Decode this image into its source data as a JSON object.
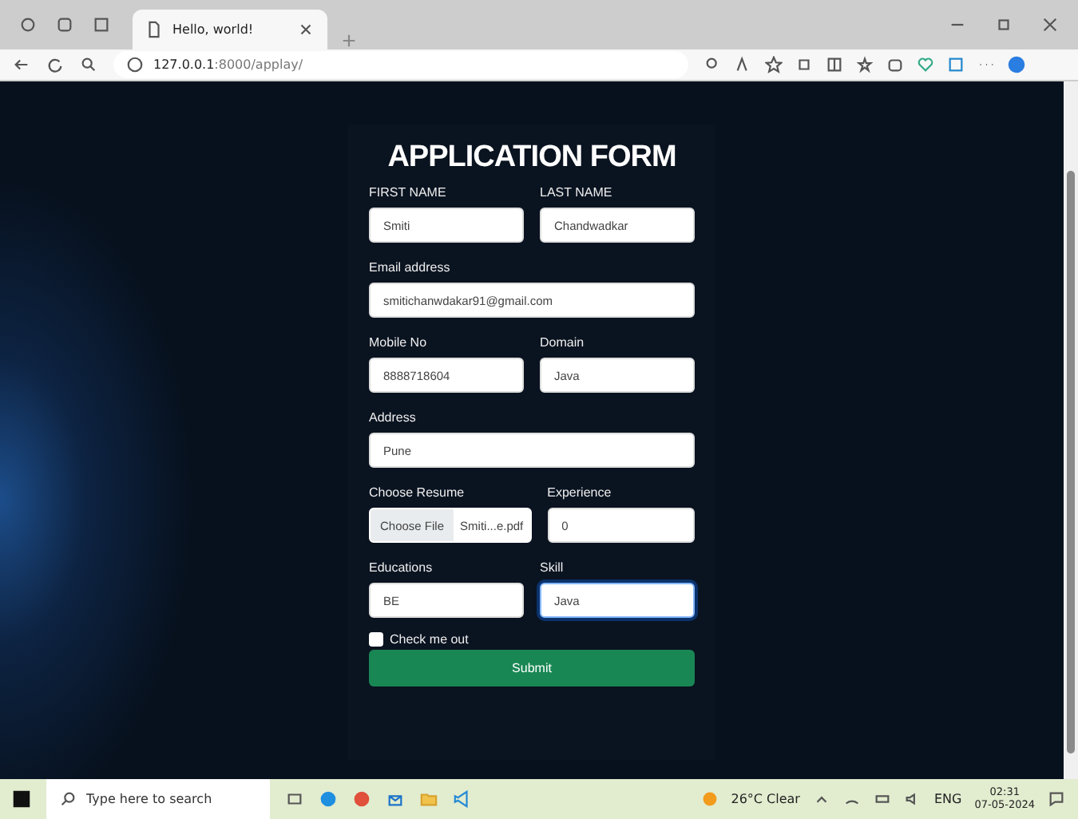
{
  "browser": {
    "tab_title": "Hello, world!",
    "url_host": "127.0.0.1",
    "url_rest": ":8000/applay/"
  },
  "form": {
    "title": "APPLICATION FORM",
    "rows": [
      [
        {
          "kind": "text",
          "label": "FIRST NAME",
          "value": "Smiti",
          "focused": false
        },
        {
          "kind": "text",
          "label": "LAST NAME",
          "value": "Chandwadkar",
          "focused": false
        }
      ],
      [
        {
          "kind": "text",
          "label": "Email address",
          "value": "smitichanwdakar91@gmail.com",
          "focused": false
        }
      ],
      [
        {
          "kind": "text",
          "label": "Mobile No",
          "value": "8888718604",
          "focused": false
        },
        {
          "kind": "text",
          "label": "Domain",
          "value": "Java",
          "focused": false
        }
      ],
      [
        {
          "kind": "text",
          "label": "Address",
          "value": "Pune",
          "focused": false
        }
      ],
      [
        {
          "kind": "file",
          "label": "Choose Resume",
          "button": "Choose File",
          "value": "Smiti...e.pdf",
          "focused": false
        },
        {
          "kind": "text",
          "label": "Experience",
          "value": "0",
          "focused": false
        }
      ],
      [
        {
          "kind": "text",
          "label": "Educations",
          "value": "BE",
          "focused": false
        },
        {
          "kind": "text",
          "label": "Skill",
          "value": "Java",
          "focused": true
        }
      ]
    ],
    "checkbox": {
      "label": "Check me out",
      "checked": false
    },
    "submit": "Submit"
  },
  "taskbar": {
    "search_placeholder": "Type here to search",
    "weather": "26°C  Clear",
    "language": "ENG",
    "time": "02:31",
    "date": "07-05-2024"
  }
}
